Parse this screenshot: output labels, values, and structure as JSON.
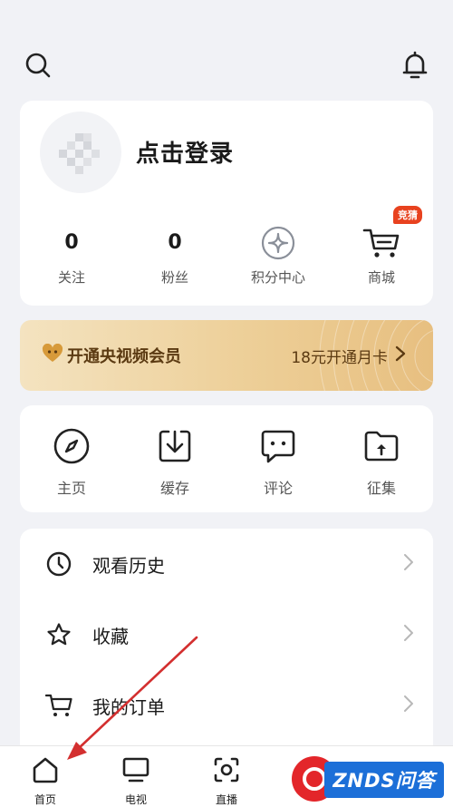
{
  "profile": {
    "login_text": "点击登录",
    "stats": [
      {
        "value": "0",
        "label": "关注"
      },
      {
        "value": "0",
        "label": "粉丝"
      },
      {
        "icon": "points-icon",
        "label": "积分中心"
      },
      {
        "icon": "cart-icon",
        "label": "商城",
        "badge": "竞猜"
      }
    ]
  },
  "vip": {
    "title": "开通央视频会员",
    "offer": "18元开通月卡"
  },
  "tools": [
    {
      "icon": "compass-icon",
      "label": "主页"
    },
    {
      "icon": "download-icon",
      "label": "缓存"
    },
    {
      "icon": "comment-icon",
      "label": "评论"
    },
    {
      "icon": "folder-upload-icon",
      "label": "征集"
    }
  ],
  "menu": [
    {
      "icon": "clock-icon",
      "label": "观看历史"
    },
    {
      "icon": "star-icon",
      "label": "收藏"
    },
    {
      "icon": "cart-icon",
      "label": "我的订单"
    }
  ],
  "tabbar": [
    {
      "icon": "home-icon",
      "label": "首页"
    },
    {
      "icon": "tv-icon",
      "label": "电视"
    },
    {
      "icon": "live-icon",
      "label": "直播"
    }
  ],
  "watermark": {
    "text": "ZNDS问答"
  },
  "colors": {
    "accent": "#e8421f",
    "vip_text": "#5b3a12",
    "watermark_blue": "#1c6fd8",
    "arrow": "#d32f2f"
  }
}
